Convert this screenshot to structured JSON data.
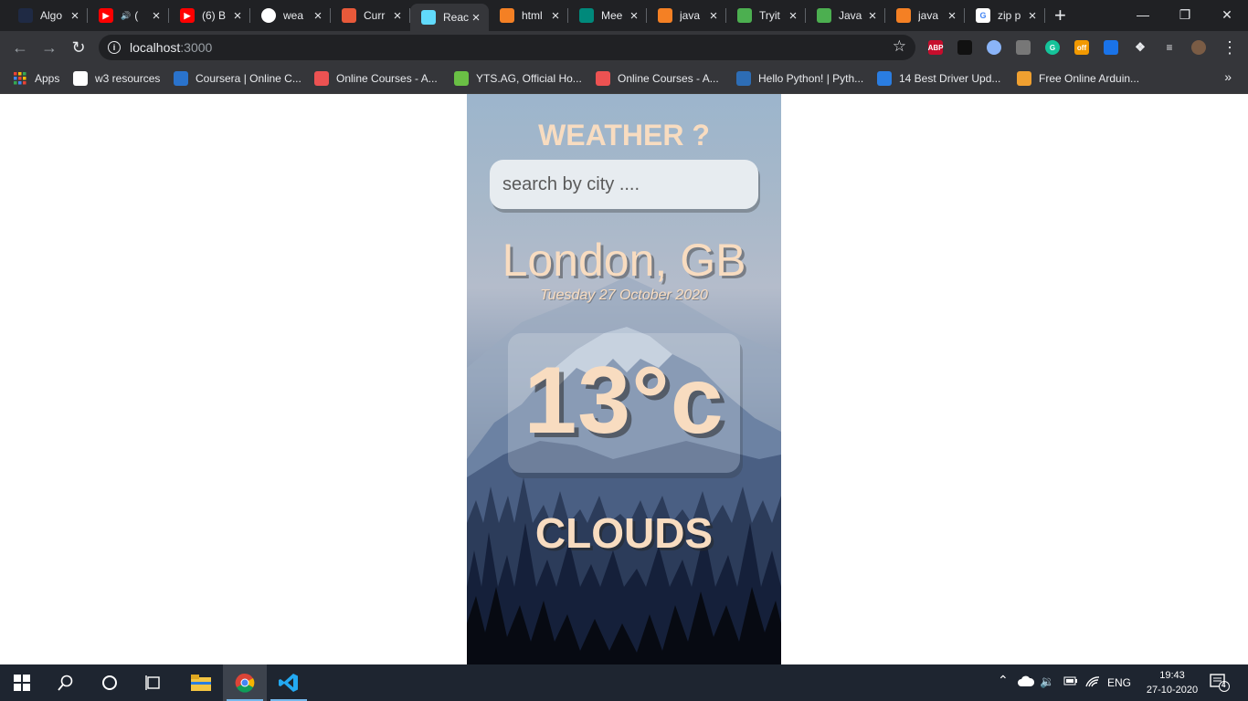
{
  "tabs": [
    {
      "title": "Algo",
      "icon": "react-icon",
      "color": "#1f2a44"
    },
    {
      "title": "(",
      "icon": "youtube-icon",
      "color": "#ff0000",
      "audio": true
    },
    {
      "title": "(6) B",
      "icon": "youtube-icon",
      "color": "#ff0000"
    },
    {
      "title": "wea",
      "icon": "github-icon",
      "color": "#ffffff"
    },
    {
      "title": "Curr",
      "icon": "coursera-icon",
      "color": "#e8593a"
    },
    {
      "title": "Reac",
      "icon": "react-icon",
      "color": "#61dafb",
      "active": true
    },
    {
      "title": "html",
      "icon": "stackoverflow-icon",
      "color": "#f48024"
    },
    {
      "title": "Mee",
      "icon": "meet-icon",
      "color": "#00897b"
    },
    {
      "title": "java",
      "icon": "stackoverflow-icon",
      "color": "#f48024"
    },
    {
      "title": "Tryit",
      "icon": "w3schools-icon",
      "color": "#4caf50"
    },
    {
      "title": "Java",
      "icon": "w3schools-icon",
      "color": "#4caf50"
    },
    {
      "title": "java",
      "icon": "stackoverflow-icon",
      "color": "#f48024"
    },
    {
      "title": "zip p",
      "icon": "google-icon",
      "color": "#ffffff"
    }
  ],
  "address": {
    "host": "localhost",
    "port": ":3000"
  },
  "extensions": [
    {
      "name": "adblock-plus-icon",
      "label": "ABP",
      "color": "#c70d2c"
    },
    {
      "name": "cube-extension-icon",
      "label": "",
      "color": "#111111"
    },
    {
      "name": "circle-extension-icon",
      "label": "",
      "color": "#8ab4f8"
    },
    {
      "name": "bulb-extension-icon",
      "label": "",
      "color": "#777777"
    },
    {
      "name": "grammarly-icon",
      "label": "G",
      "color": "#15c39a"
    },
    {
      "name": "home-off-extension-icon",
      "label": "off",
      "color": "#f29900"
    },
    {
      "name": "bookmark-extension-icon",
      "label": "",
      "color": "#1a73e8"
    },
    {
      "name": "puzzle-extensions-icon",
      "label": "",
      "color": "#35363a"
    },
    {
      "name": "media-queue-icon",
      "label": "",
      "color": "#35363a"
    },
    {
      "name": "profile-avatar-icon",
      "label": "",
      "color": "#7a5c45"
    }
  ],
  "bookmarks": [
    {
      "label": "Apps",
      "icon": "apps-grid-icon",
      "color": "#e8453c"
    },
    {
      "label": "w3 resources",
      "icon": "w3r-icon",
      "color": "#ffffff"
    },
    {
      "label": "Coursera | Online C...",
      "icon": "coursera-icon",
      "color": "#2a73cc"
    },
    {
      "label": "Online Courses - A...",
      "icon": "udemy-icon",
      "color": "#ec5252"
    },
    {
      "label": "YTS.AG, Official Ho...",
      "icon": "yts-icon",
      "color": "#6ac045"
    },
    {
      "label": "Online Courses - A...",
      "icon": "udemy-icon",
      "color": "#ec5252"
    },
    {
      "label": "Hello Python! | Pyth...",
      "icon": "shield-icon",
      "color": "#2d6db5"
    },
    {
      "label": "14 Best Driver Upd...",
      "icon": "wp-icon",
      "color": "#2a7de1"
    },
    {
      "label": "Free Online Arduin...",
      "icon": "arduino-icon",
      "color": "#f0a030"
    }
  ],
  "weather": {
    "heading": "WEATHER ?",
    "search_placeholder": "search by city ....",
    "location": "London, GB",
    "date": "Tuesday 27 October 2020",
    "temperature": "13°c",
    "condition": "CLOUDS"
  },
  "taskbar": {
    "language": "ENG",
    "time": "19:43",
    "date": "27-10-2020",
    "notifications": "4"
  }
}
